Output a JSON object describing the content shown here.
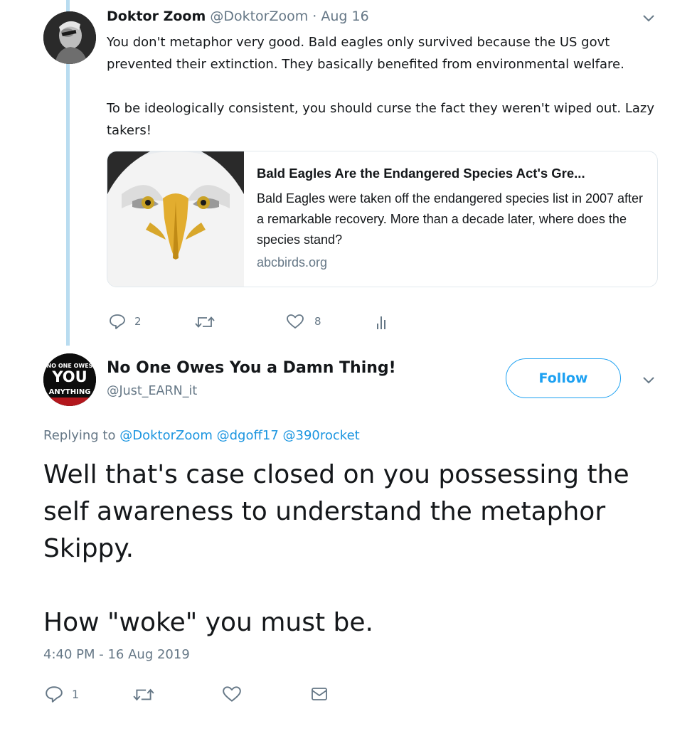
{
  "tweet1": {
    "name": "Doktor Zoom",
    "handle": "@DoktorZoom",
    "separator": "·",
    "date": "Aug 16",
    "paragraphs": [
      "You don't metaphor very good. Bald eagles only survived because the US govt prevented their extinction. They basically benefited from environmental welfare.",
      "To be ideologically consistent, you should curse the fact they weren't wiped out. Lazy takers!"
    ],
    "card": {
      "title": "Bald Eagles Are the Endangered Species Act's Gre...",
      "description": "Bald Eagles were taken off the endangered species list in 2007 after a remarkable recovery. More than a decade later, where does the species stand?",
      "domain": "abcbirds.org"
    },
    "actions": {
      "reply_count": "2",
      "retweet_count": "",
      "like_count": "8"
    }
  },
  "tweet2": {
    "name": "No One Owes You a Damn Thing!",
    "handle": "@Just_EARN_it",
    "follow_label": "Follow",
    "replying_to_label": "Replying to",
    "mentions": [
      "@DoktorZoom",
      "@dgoff17",
      "@390rocket"
    ],
    "paragraphs": [
      "Well that's case closed on you possessing the self awareness to understand the metaphor Skippy.",
      "How \"woke\" you must be."
    ],
    "timestamp": "4:40 PM - 16 Aug 2019",
    "actions": {
      "reply_count": "1"
    },
    "avatar_text": {
      "line1": "NO ONE OWES",
      "line2": "YOU",
      "line3": "ANYTHING"
    }
  },
  "colors": {
    "accent": "#1da1f2",
    "link": "#1b95e0",
    "muted": "#657786",
    "thread_line": "#b9dcf0"
  },
  "icons": [
    "reply-icon",
    "retweet-icon",
    "like-icon",
    "analytics-icon",
    "direct-message-icon",
    "chevron-down-icon"
  ]
}
